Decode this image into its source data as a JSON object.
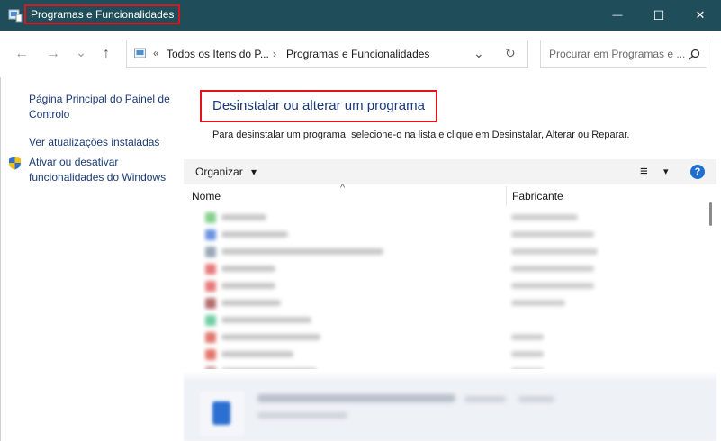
{
  "window": {
    "title": "Programas e Funcionalidades",
    "minimize_glyph": "—",
    "maximize_glyph": "☐",
    "close_glyph": "✕"
  },
  "nav": {
    "back_glyph": "←",
    "forward_glyph": "→",
    "recent_glyph": "⌄",
    "up_glyph": "↑"
  },
  "address": {
    "overflow": "«",
    "crumbs": [
      "Todos os Itens do P...",
      "Programas e Funcionalidades"
    ],
    "separator": "›",
    "dropdown_glyph": "⌄",
    "refresh_glyph": "↻"
  },
  "search": {
    "placeholder": "Procurar em Programas e ...",
    "icon_glyph": "⌕"
  },
  "sidebar": {
    "items": [
      "Página Principal do Painel de Controlo",
      "Ver atualizações instaladas",
      "Ativar ou desativar funcionalidades do Windows"
    ]
  },
  "main": {
    "heading": "Desinstalar ou alterar um programa",
    "description": "Para desinstalar um programa, selecione-o na lista e clique em Desinstalar, Alterar ou Reparar."
  },
  "toolbar": {
    "organize_label": "Organizar",
    "organize_caret": "▾",
    "view_glyph": "≡",
    "view_caret": "▾",
    "help_glyph": "?"
  },
  "columns": {
    "name": "Nome",
    "publisher": "Fabricante",
    "sort_glyph": "^"
  },
  "colors": {
    "titlebar": "#204d5a",
    "highlight_border": "#e0141e",
    "link": "#1a3a76",
    "help_icon": "#1f6fd1"
  }
}
